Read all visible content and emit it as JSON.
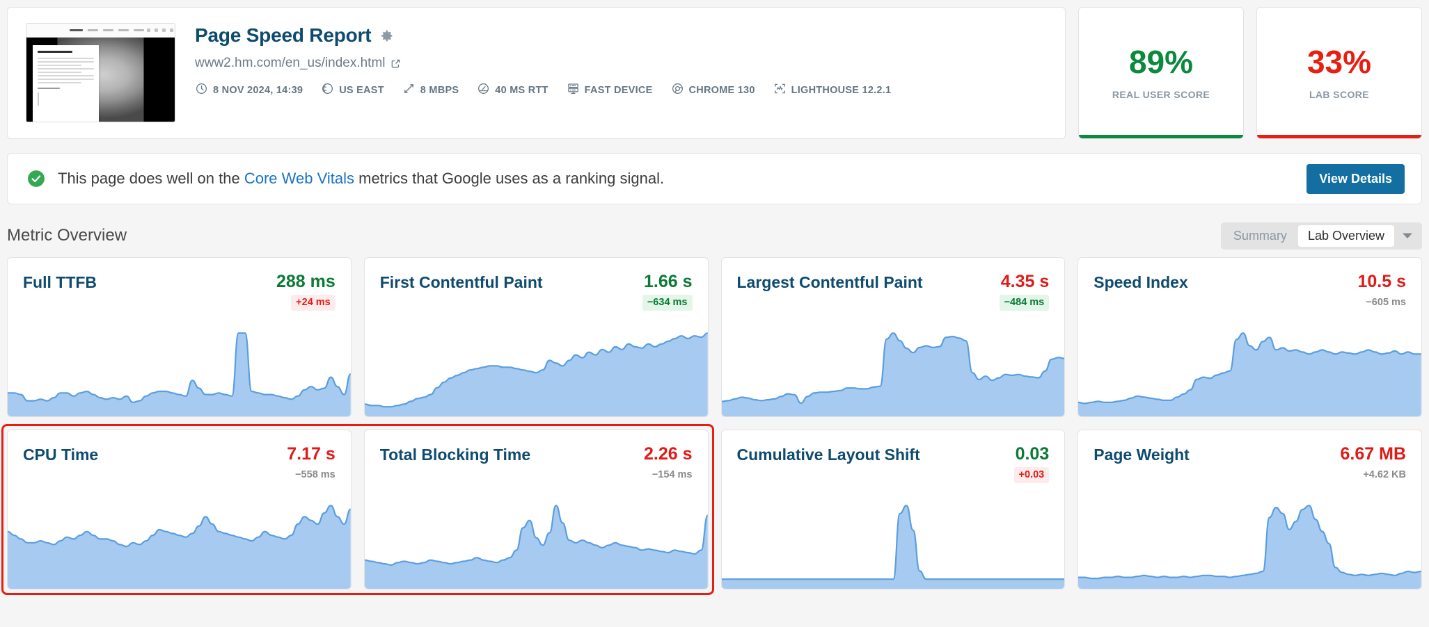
{
  "report": {
    "title": "Page Speed Report",
    "gear_icon": "gear-icon",
    "url": "www2.hm.com/en_us/index.html",
    "external_link_icon": "external-link-icon",
    "meta": [
      {
        "icon": "clock-icon",
        "label": "8 NOV 2024, 14:39"
      },
      {
        "icon": "globe-icon",
        "label": "US EAST"
      },
      {
        "icon": "bandwidth-icon",
        "label": "8 MBPS"
      },
      {
        "icon": "latency-icon",
        "label": "40 MS RTT"
      },
      {
        "icon": "server-icon",
        "label": "FAST DEVICE"
      },
      {
        "icon": "chrome-icon",
        "label": "CHROME 130"
      },
      {
        "icon": "lighthouse-icon",
        "label": "LIGHTHOUSE 12.2.1"
      }
    ]
  },
  "scores": [
    {
      "value": "89%",
      "label": "REAL USER SCORE",
      "color": "#0a8a3c"
    },
    {
      "value": "33%",
      "label": "LAB SCORE",
      "color": "#e81e10"
    }
  ],
  "banner": {
    "check_icon": "check-circle-icon",
    "text_before": "This page does well on the ",
    "link_text": "Core Web Vitals",
    "text_after": " metrics that Google uses as a ranking signal.",
    "button_label": "View Details",
    "button_color": "#136fa1"
  },
  "metric_overview": {
    "title": "Metric Overview",
    "segments": [
      {
        "label": "Summary",
        "active": false
      },
      {
        "label": "Lab Overview",
        "active": true
      }
    ],
    "caret_icon": "chevron-down-icon"
  },
  "chart_data": [
    {
      "type": "area",
      "title": "Full TTFB",
      "value": "288 ms",
      "value_state": "good",
      "delta": "+24 ms",
      "delta_state": "up",
      "ylabel": "",
      "xlabel": "",
      "values": [
        14,
        14,
        13,
        9,
        9,
        10,
        9,
        11,
        14,
        14,
        12,
        14,
        15,
        13,
        11,
        10,
        11,
        10,
        12,
        8,
        9,
        12,
        14,
        15,
        15,
        14,
        13,
        12,
        22,
        17,
        13,
        13,
        14,
        13,
        12,
        52,
        52,
        15,
        14,
        13,
        13,
        12,
        11,
        10,
        12,
        16,
        18,
        16,
        17,
        24,
        18,
        13,
        26
      ]
    },
    {
      "type": "area",
      "title": "First Contentful Paint",
      "value": "1.66 s",
      "value_state": "good",
      "delta": "−634 ms",
      "delta_state": "down",
      "ylabel": "",
      "xlabel": "",
      "values": [
        8,
        7,
        7,
        6,
        6,
        7,
        8,
        10,
        12,
        13,
        15,
        20,
        24,
        27,
        29,
        31,
        33,
        34,
        35,
        36,
        36,
        35,
        35,
        34,
        33,
        32,
        31,
        33,
        40,
        38,
        36,
        40,
        44,
        42,
        46,
        44,
        48,
        46,
        50,
        48,
        52,
        50,
        49,
        52,
        50,
        52,
        54,
        56,
        58,
        56,
        58,
        57,
        60
      ]
    },
    {
      "type": "area",
      "title": "Largest Contentful Paint",
      "value": "4.35 s",
      "value_state": "bad",
      "delta": "−484 ms",
      "delta_state": "down",
      "ylabel": "",
      "xlabel": "",
      "values": [
        16,
        17,
        19,
        21,
        20,
        18,
        17,
        18,
        19,
        22,
        25,
        24,
        14,
        22,
        26,
        27,
        27,
        28,
        29,
        32,
        32,
        31,
        31,
        33,
        34,
        90,
        97,
        88,
        79,
        74,
        80,
        82,
        80,
        81,
        92,
        93,
        91,
        88,
        50,
        42,
        46,
        41,
        44,
        48,
        47,
        48,
        46,
        45,
        44,
        52,
        66,
        68,
        67
      ]
    },
    {
      "type": "area",
      "title": "Speed Index",
      "value": "10.5 s",
      "value_state": "bad",
      "delta": "−605 ms",
      "delta_state": "plain",
      "ylabel": "",
      "xlabel": "",
      "values": [
        12,
        11,
        12,
        13,
        12,
        12,
        13,
        14,
        16,
        18,
        17,
        16,
        15,
        14,
        14,
        17,
        20,
        24,
        34,
        36,
        35,
        38,
        40,
        42,
        72,
        78,
        66,
        62,
        70,
        74,
        62,
        64,
        61,
        62,
        60,
        58,
        60,
        62,
        60,
        58,
        60,
        59,
        58,
        60,
        62,
        60,
        58,
        59,
        61,
        58,
        60,
        58,
        58
      ]
    },
    {
      "type": "area",
      "title": "CPU Time",
      "value": "7.17 s",
      "value_state": "bad",
      "delta": "−558 ms",
      "delta_state": "plain",
      "selected": true,
      "ylabel": "",
      "xlabel": "",
      "values": [
        30,
        28,
        26,
        24,
        24,
        25,
        24,
        23,
        25,
        27,
        26,
        28,
        30,
        28,
        26,
        26,
        25,
        23,
        22,
        24,
        23,
        25,
        28,
        31,
        30,
        29,
        28,
        27,
        29,
        33,
        38,
        34,
        30,
        29,
        28,
        27,
        26,
        25,
        27,
        30,
        28,
        27,
        26,
        28,
        34,
        38,
        36,
        34,
        40,
        44,
        38,
        34,
        42
      ]
    },
    {
      "type": "area",
      "title": "Total Blocking Time",
      "value": "2.26 s",
      "value_state": "bad",
      "delta": "−154 ms",
      "delta_state": "plain",
      "selected": true,
      "ylabel": "",
      "xlabel": "",
      "values": [
        22,
        21,
        20,
        19,
        18,
        20,
        21,
        20,
        19,
        20,
        22,
        21,
        20,
        19,
        20,
        21,
        22,
        24,
        22,
        21,
        20,
        22,
        24,
        30,
        48,
        54,
        40,
        34,
        44,
        66,
        52,
        38,
        36,
        38,
        36,
        34,
        32,
        34,
        36,
        34,
        33,
        32,
        30,
        31,
        30,
        29,
        28,
        30,
        29,
        28,
        27,
        30,
        58
      ]
    },
    {
      "type": "area",
      "title": "Cumulative Layout Shift",
      "value": "0.03",
      "value_state": "good",
      "delta": "+0.03",
      "delta_state": "up",
      "ylabel": "",
      "xlabel": "",
      "values": [
        2,
        2,
        2,
        2,
        2,
        2,
        2,
        2,
        2,
        2,
        2,
        2,
        2,
        2,
        2,
        2,
        2,
        2,
        2,
        2,
        2,
        2,
        2,
        2,
        2,
        2,
        2,
        18,
        20,
        14,
        4,
        2,
        2,
        2,
        2,
        2,
        2,
        2,
        2,
        2,
        2,
        2,
        2,
        2,
        2,
        2,
        2,
        2,
        2,
        2,
        2,
        2,
        2
      ]
    },
    {
      "type": "area",
      "title": "Page Weight",
      "value": "6.67 MB",
      "value_state": "bad",
      "delta": "+4.62 KB",
      "delta_state": "plain",
      "ylabel": "",
      "xlabel": "",
      "values": [
        10,
        10,
        9,
        9,
        10,
        10,
        11,
        10,
        10,
        11,
        12,
        11,
        10,
        11,
        10,
        10,
        11,
        10,
        11,
        12,
        12,
        11,
        11,
        10,
        11,
        12,
        13,
        14,
        16,
        70,
        80,
        74,
        58,
        66,
        78,
        82,
        68,
        56,
        44,
        20,
        15,
        13,
        12,
        13,
        12,
        13,
        14,
        13,
        12,
        14,
        16,
        15,
        16
      ]
    }
  ]
}
